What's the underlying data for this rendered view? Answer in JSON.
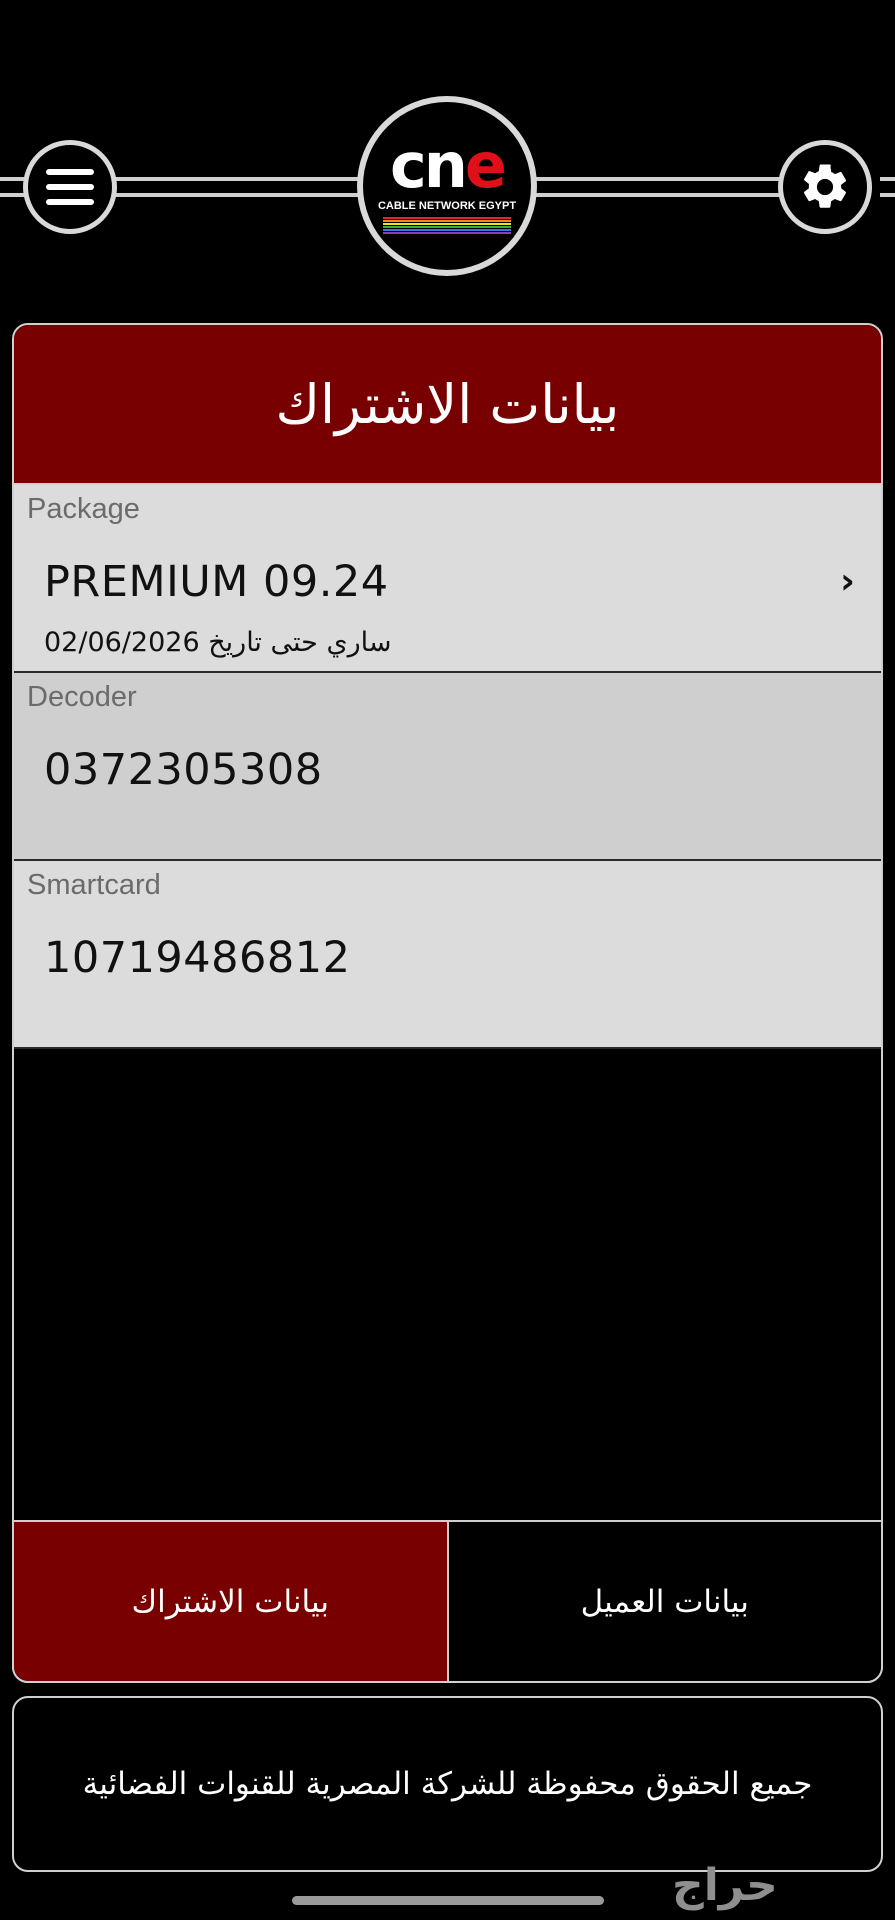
{
  "header": {
    "logo": {
      "word_prefix": "cn",
      "word_accent": "e",
      "subtitle": "CABLE NETWORK EGYPT"
    },
    "menu_icon": "hamburger-menu-icon",
    "settings_icon": "gear-icon"
  },
  "card": {
    "title": "بيانات الاشتراك",
    "package": {
      "label": "Package",
      "value": "PREMIUM 09.24",
      "subtext": "ساري حتى تاريخ 02/06/2026"
    },
    "decoder": {
      "label": "Decoder",
      "value": "0372305308"
    },
    "smartcard": {
      "label": "Smartcard",
      "value": "10719486812"
    }
  },
  "tabs": {
    "subscription": "بيانات الاشتراك",
    "customer": "بيانات العميل"
  },
  "footer": {
    "copyright": "جميع الحقوق محفوظة للشركة المصرية للقنوات الفضائية"
  },
  "watermark": "حراج",
  "colors": {
    "accent_red": "#780000",
    "row_background": "#dcdcdc",
    "background": "#000000"
  }
}
